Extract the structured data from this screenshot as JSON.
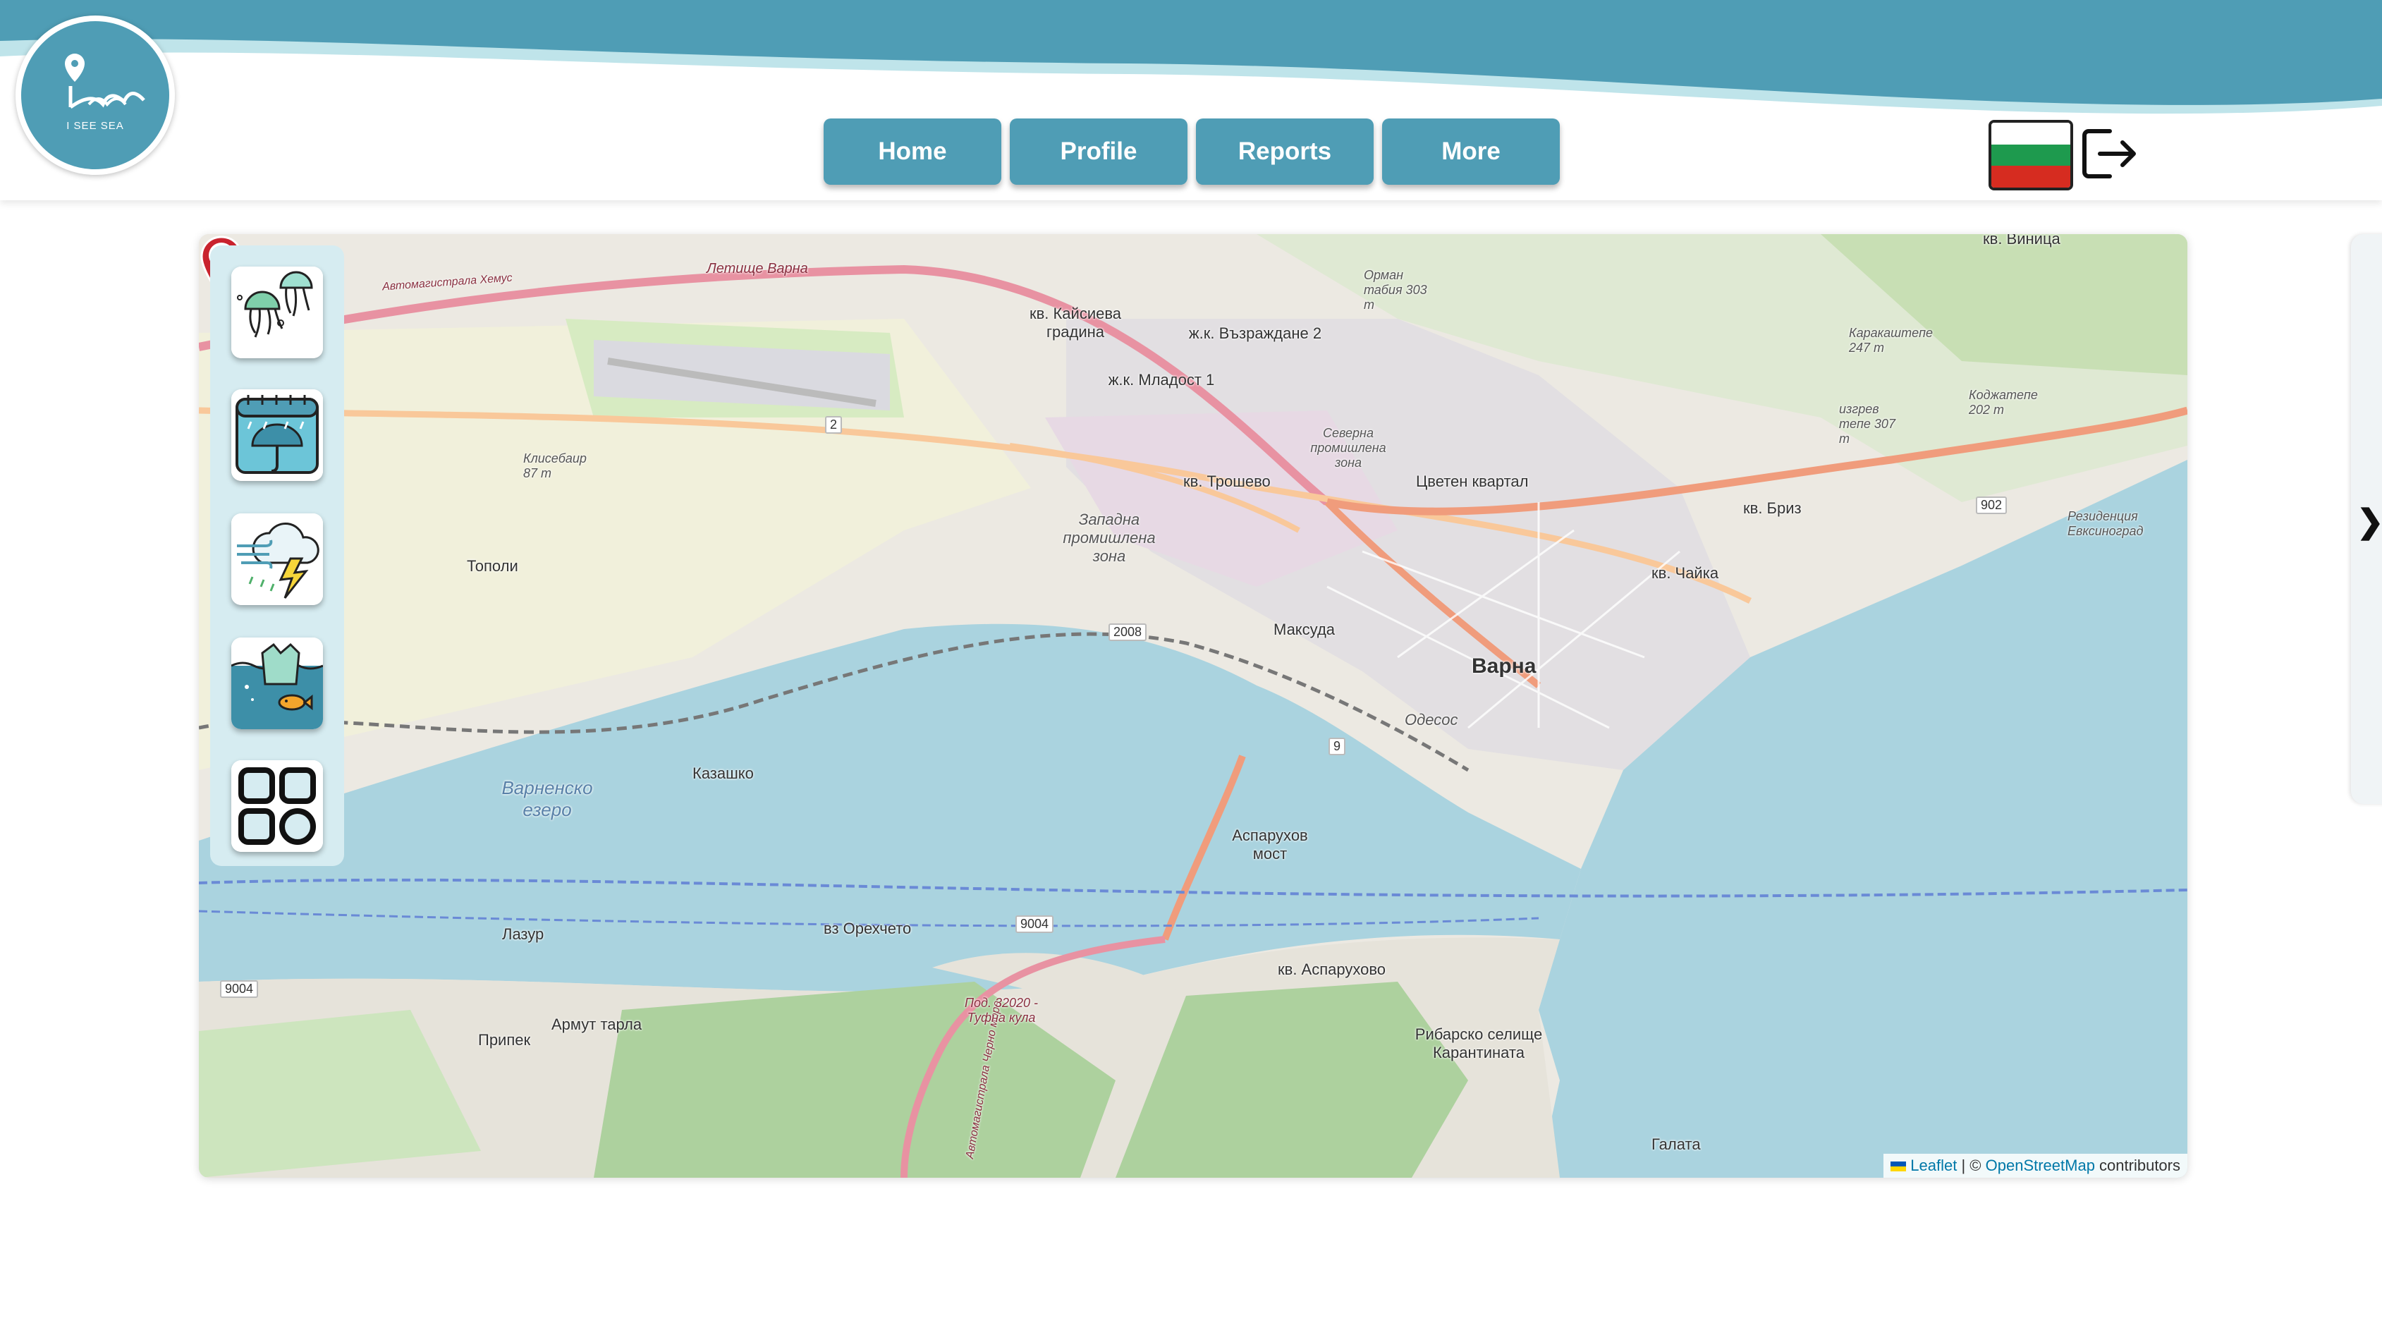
{
  "brand": {
    "logo_text": "I SEE SEA",
    "primary_color": "#4f9db5"
  },
  "nav": {
    "items": [
      {
        "label": "Home"
      },
      {
        "label": "Profile"
      },
      {
        "label": "Reports"
      },
      {
        "label": "More"
      }
    ]
  },
  "header": {
    "language_flag": "bulgaria-flag-icon",
    "logout_icon": "logout-icon"
  },
  "sidebar": {
    "tools": [
      {
        "icon": "jellyfish-icon"
      },
      {
        "icon": "rain-umbrella-calendar-icon"
      },
      {
        "icon": "storm-wind-lightning-icon"
      },
      {
        "icon": "water-pollution-fish-icon"
      },
      {
        "icon": "more-apps-grid-icon"
      }
    ]
  },
  "map": {
    "attribution": {
      "leaflet": "Leaflet",
      "separator": " | © ",
      "osm": "OpenStreetMap",
      "suffix": " contributors"
    },
    "labels": {
      "varna": "Варна",
      "vinica": "кв. Виница",
      "kaisieva": "кв. Кайсиева градина",
      "vazrazhdane": "ж.к. Възраждане 2",
      "mladost": "ж.к. Младост 1",
      "troshevo": "кв. Трошево",
      "tsveten": "Цветен квартал",
      "briz": "кв. Бриз",
      "chaika": "кв. Чайка",
      "maksuda": "Максуда",
      "topoli": "Тополи",
      "kazashko": "Казашко",
      "varna_lake": "Варненско езеро",
      "lazur": "Лазур",
      "oreh": "вз Орехчето",
      "asparuhov_most": "Аспарухов мост",
      "asparuhovo": "кв. Аспарухово",
      "armut": "Армут тарла",
      "pripek": "Припек",
      "ribarsko": "Рибарско селище Карантината",
      "galata": "Галата",
      "zapadna": "Западна промишлена зона",
      "severna": "Северна промишлена зона",
      "airport": "Летище Варна",
      "klisebair": "Клисебаир 87 m",
      "karakashtepe": "Каракаштепе 247 m",
      "kodzhatepe": "Коджатепе 202 m",
      "izgrev": "изгрев тепе 307 m",
      "orman": "Орман табия 303 m",
      "odesos": "Одесос",
      "rezidencia": "Резиденция Евксиноград",
      "hemus": "Автомагистрала Хемус",
      "cherno_more": "Автомагистрала Черно море",
      "pod": "Под. 32020 - Туфна кула"
    },
    "shields": {
      "r2": "2",
      "r2008": "2008",
      "r9004": "9004",
      "r9004w": "9004",
      "r902": "902",
      "r9": "9"
    }
  }
}
